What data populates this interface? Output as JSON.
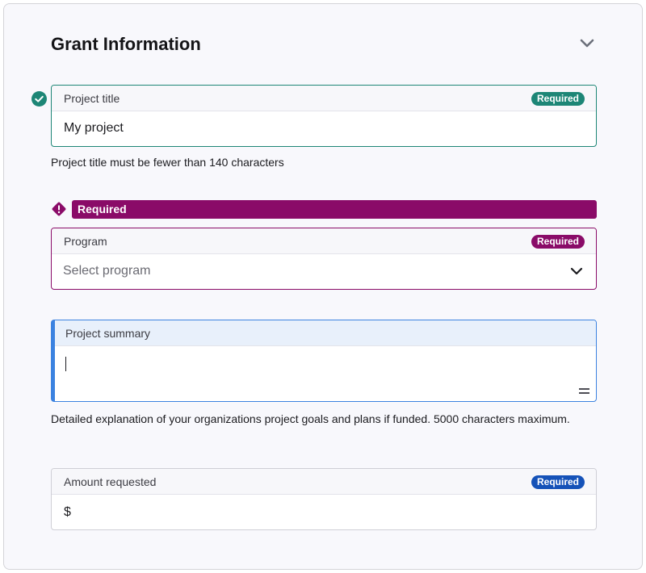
{
  "section": {
    "title": "Grant Information"
  },
  "icons": {
    "collapse": "chevron-down-icon",
    "valid": "check-circle-icon",
    "error": "exclamation-diamond-icon",
    "select": "chevron-down-icon",
    "resize": "resize-handle-icon"
  },
  "colors": {
    "success": "#1d8676",
    "error": "#8a0b68",
    "focus": "#3b82e0",
    "required_badge_blue": "#1552b8"
  },
  "fields": {
    "project_title": {
      "label": "Project title",
      "badge": "Required",
      "value": "My project",
      "hint": "Project title must be fewer than 140 characters"
    },
    "program": {
      "error": "Required",
      "label": "Program",
      "badge": "Required",
      "placeholder": "Select program"
    },
    "project_summary": {
      "label": "Project summary",
      "value": "",
      "hint": "Detailed explanation of your organizations project goals and plans if funded. 5000 characters maximum."
    },
    "amount_requested": {
      "label": "Amount requested",
      "badge": "Required",
      "prefix": "$"
    }
  }
}
